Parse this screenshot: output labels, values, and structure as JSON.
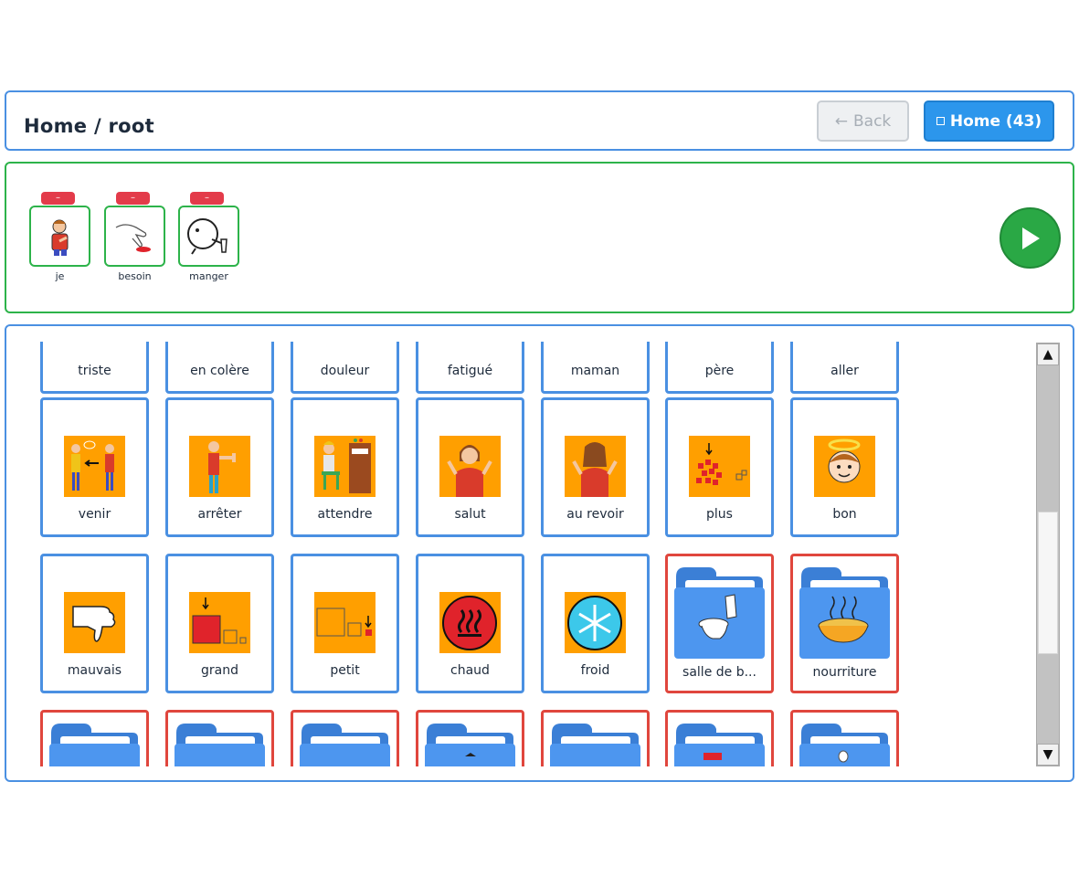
{
  "header": {
    "breadcrumb": "Home / root",
    "back_label": "Back",
    "home_label": "Home (43)"
  },
  "sentence": {
    "remove_label": "–",
    "items": [
      {
        "label": "je",
        "icon": "person-pointing-self-icon"
      },
      {
        "label": "besoin",
        "icon": "hand-pressing-button-icon"
      },
      {
        "label": "manger",
        "icon": "person-eating-icon"
      }
    ],
    "play_icon": "play-icon"
  },
  "grid": {
    "row0": [
      "triste",
      "en colère",
      "douleur",
      "fatigué",
      "maman",
      "père",
      "aller"
    ],
    "row1": [
      "venir",
      "arrêter",
      "attendre",
      "salut",
      "au revoir",
      "plus",
      "bon"
    ],
    "row2": [
      "mauvais",
      "grand",
      "petit",
      "chaud",
      "froid",
      "salle de b...",
      "nourriture"
    ],
    "row2_types": [
      "word",
      "word",
      "word",
      "word",
      "word",
      "folder",
      "folder"
    ]
  },
  "colors": {
    "primary_blue": "#4a90e2",
    "folder_border": "#e0463d",
    "sentence_green": "#2db34a",
    "symbol_orange": "#ff9f00",
    "folder_blue": "#4d96ef"
  }
}
